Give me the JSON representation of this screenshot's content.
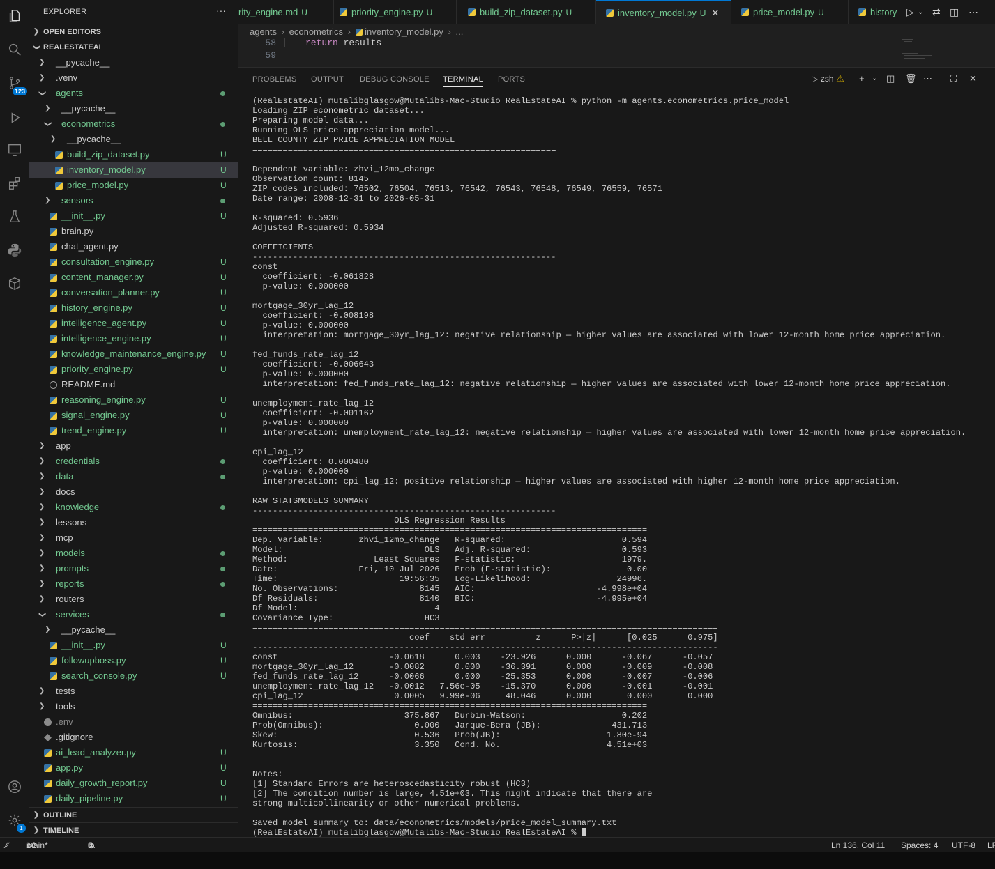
{
  "explorer": {
    "title": "EXPLORER",
    "more": "···",
    "open_editors": "OPEN EDITORS",
    "root": "REALESTATEAI",
    "outline": "OUTLINE",
    "timeline": "TIMELINE",
    "items": [
      {
        "label": "__pycache__",
        "kind": "folder",
        "depth": 0,
        "color": "w",
        "badge": ""
      },
      {
        "label": ".venv",
        "kind": "folder",
        "depth": 0,
        "color": "w",
        "badge": ""
      },
      {
        "label": "agents",
        "kind": "folder-open",
        "depth": 0,
        "color": "g",
        "badge": "dot"
      },
      {
        "label": "__pycache__",
        "kind": "folder",
        "depth": 1,
        "color": "w",
        "badge": ""
      },
      {
        "label": "econometrics",
        "kind": "folder-open",
        "depth": 1,
        "color": "g",
        "badge": "dot"
      },
      {
        "label": "__pycache__",
        "kind": "folder",
        "depth": 2,
        "color": "w",
        "badge": ""
      },
      {
        "label": "build_zip_dataset.py",
        "kind": "py",
        "depth": 2,
        "color": "g",
        "badge": "U"
      },
      {
        "label": "inventory_model.py",
        "kind": "py",
        "depth": 2,
        "color": "g",
        "badge": "U",
        "selected": true
      },
      {
        "label": "price_model.py",
        "kind": "py",
        "depth": 2,
        "color": "g",
        "badge": "U"
      },
      {
        "label": "sensors",
        "kind": "folder",
        "depth": 1,
        "color": "g",
        "badge": "dot"
      },
      {
        "label": "__init__.py",
        "kind": "py",
        "depth": 1,
        "color": "g",
        "badge": "U"
      },
      {
        "label": "brain.py",
        "kind": "py",
        "depth": 1,
        "color": "w",
        "badge": ""
      },
      {
        "label": "chat_agent.py",
        "kind": "py",
        "depth": 1,
        "color": "w",
        "badge": ""
      },
      {
        "label": "consultation_engine.py",
        "kind": "py",
        "depth": 1,
        "color": "g",
        "badge": "U"
      },
      {
        "label": "content_manager.py",
        "kind": "py",
        "depth": 1,
        "color": "g",
        "badge": "U"
      },
      {
        "label": "conversation_planner.py",
        "kind": "py",
        "depth": 1,
        "color": "g",
        "badge": "U"
      },
      {
        "label": "history_engine.py",
        "kind": "py",
        "depth": 1,
        "color": "g",
        "badge": "U"
      },
      {
        "label": "intelligence_agent.py",
        "kind": "py",
        "depth": 1,
        "color": "g",
        "badge": "U"
      },
      {
        "label": "intelligence_engine.py",
        "kind": "py",
        "depth": 1,
        "color": "g",
        "badge": "U"
      },
      {
        "label": "knowledge_maintenance_engine.py",
        "kind": "py",
        "depth": 1,
        "color": "g",
        "badge": "U"
      },
      {
        "label": "priority_engine.py",
        "kind": "py",
        "depth": 1,
        "color": "g",
        "badge": "U"
      },
      {
        "label": "README.md",
        "kind": "info",
        "depth": 1,
        "color": "w",
        "badge": ""
      },
      {
        "label": "reasoning_engine.py",
        "kind": "py",
        "depth": 1,
        "color": "g",
        "badge": "U"
      },
      {
        "label": "signal_engine.py",
        "kind": "py",
        "depth": 1,
        "color": "g",
        "badge": "U"
      },
      {
        "label": "trend_engine.py",
        "kind": "py",
        "depth": 1,
        "color": "g",
        "badge": "U"
      },
      {
        "label": "app",
        "kind": "folder",
        "depth": 0,
        "color": "w",
        "badge": ""
      },
      {
        "label": "credentials",
        "kind": "folder",
        "depth": 0,
        "color": "g",
        "badge": "dot"
      },
      {
        "label": "data",
        "kind": "folder",
        "depth": 0,
        "color": "g",
        "badge": "dot"
      },
      {
        "label": "docs",
        "kind": "folder",
        "depth": 0,
        "color": "w",
        "badge": ""
      },
      {
        "label": "knowledge",
        "kind": "folder",
        "depth": 0,
        "color": "g",
        "badge": "dot"
      },
      {
        "label": "lessons",
        "kind": "folder",
        "depth": 0,
        "color": "w",
        "badge": ""
      },
      {
        "label": "mcp",
        "kind": "folder",
        "depth": 0,
        "color": "w",
        "badge": ""
      },
      {
        "label": "models",
        "kind": "folder",
        "depth": 0,
        "color": "g",
        "badge": "dot"
      },
      {
        "label": "prompts",
        "kind": "folder",
        "depth": 0,
        "color": "g",
        "badge": "dot"
      },
      {
        "label": "reports",
        "kind": "folder",
        "depth": 0,
        "color": "g",
        "badge": "dot"
      },
      {
        "label": "routers",
        "kind": "folder",
        "depth": 0,
        "color": "w",
        "badge": ""
      },
      {
        "label": "services",
        "kind": "folder-open",
        "depth": 0,
        "color": "g",
        "badge": "dot"
      },
      {
        "label": "__pycache__",
        "kind": "folder",
        "depth": 1,
        "color": "w",
        "badge": ""
      },
      {
        "label": "__init__.py",
        "kind": "py",
        "depth": 1,
        "color": "g",
        "badge": "U"
      },
      {
        "label": "followupboss.py",
        "kind": "py",
        "depth": 1,
        "color": "g",
        "badge": "U"
      },
      {
        "label": "search_console.py",
        "kind": "py",
        "depth": 1,
        "color": "g",
        "badge": "U"
      },
      {
        "label": "tests",
        "kind": "folder",
        "depth": 0,
        "color": "w",
        "badge": ""
      },
      {
        "label": "tools",
        "kind": "folder",
        "depth": 0,
        "color": "w",
        "badge": ""
      },
      {
        "label": ".env",
        "kind": "gear",
        "depth": 0,
        "color": "gy",
        "badge": ""
      },
      {
        "label": ".gitignore",
        "kind": "git",
        "depth": 0,
        "color": "w",
        "badge": ""
      },
      {
        "label": "ai_lead_analyzer.py",
        "kind": "py",
        "depth": 0,
        "color": "g",
        "badge": "U"
      },
      {
        "label": "app.py",
        "kind": "py",
        "depth": 0,
        "color": "g",
        "badge": "U"
      },
      {
        "label": "daily_growth_report.py",
        "kind": "py",
        "depth": 0,
        "color": "g",
        "badge": "U"
      },
      {
        "label": "daily_pipeline.py",
        "kind": "py",
        "depth": 0,
        "color": "g",
        "badge": "U"
      }
    ]
  },
  "activity": {
    "scm_badge": "123",
    "settings_badge": "1"
  },
  "tabs": [
    {
      "label": "rity_engine.md",
      "badge": "U",
      "icon": "md",
      "active": false
    },
    {
      "label": "priority_engine.py",
      "badge": "U",
      "icon": "py",
      "active": false
    },
    {
      "label": "build_zip_dataset.py",
      "badge": "U",
      "icon": "py",
      "active": false
    },
    {
      "label": "inventory_model.py",
      "badge": "U",
      "icon": "py",
      "active": true
    },
    {
      "label": "price_model.py",
      "badge": "U",
      "icon": "py",
      "active": false
    },
    {
      "label": "history",
      "badge": "",
      "icon": "py",
      "active": false
    }
  ],
  "breadcrumb": [
    "agents",
    "econometrics",
    "inventory_model.py",
    "..."
  ],
  "code": {
    "lines": [
      {
        "num": "58",
        "kw": "return",
        "text": "results"
      },
      {
        "num": "59",
        "kw": "",
        "text": ""
      }
    ]
  },
  "panel": {
    "tabs": [
      "PROBLEMS",
      "OUTPUT",
      "DEBUG CONSOLE",
      "TERMINAL",
      "PORTS"
    ],
    "active_tab": "TERMINAL",
    "shell": "zsh"
  },
  "terminal": {
    "lines": [
      "(RealEstateAI) mutalibglasgow@Mutalibs-Mac-Studio RealEstateAI % python -m agents.econometrics.price_model",
      "Loading ZIP econometric dataset...",
      "Preparing model data...",
      "Running OLS price appreciation model...",
      "BELL COUNTY ZIP PRICE APPRECIATION MODEL",
      "============================================================",
      "",
      "Dependent variable: zhvi_12mo_change",
      "Observation count: 8145",
      "ZIP codes included: 76502, 76504, 76513, 76542, 76543, 76548, 76549, 76559, 76571",
      "Date range: 2008-12-31 to 2026-05-31",
      "",
      "R-squared: 0.5936",
      "Adjusted R-squared: 0.5934",
      "",
      "COEFFICIENTS",
      "------------------------------------------------------------",
      "const",
      "  coefficient: -0.061828",
      "  p-value: 0.000000",
      "",
      "mortgage_30yr_lag_12",
      "  coefficient: -0.008198",
      "  p-value: 0.000000",
      "  interpretation: mortgage_30yr_lag_12: negative relationship — higher values are associated with lower 12-month home price appreciation.",
      "",
      "fed_funds_rate_lag_12",
      "  coefficient: -0.006643",
      "  p-value: 0.000000",
      "  interpretation: fed_funds_rate_lag_12: negative relationship — higher values are associated with lower 12-month home price appreciation.",
      "",
      "unemployment_rate_lag_12",
      "  coefficient: -0.001162",
      "  p-value: 0.000000",
      "  interpretation: unemployment_rate_lag_12: negative relationship — higher values are associated with lower 12-month home price appreciation.",
      "",
      "cpi_lag_12",
      "  coefficient: 0.000480",
      "  p-value: 0.000000",
      "  interpretation: cpi_lag_12: positive relationship — higher values are associated with higher 12-month home price appreciation.",
      "",
      "RAW STATSMODELS SUMMARY",
      "------------------------------------------------------------",
      "                            OLS Regression Results",
      "==============================================================================",
      "Dep. Variable:       zhvi_12mo_change   R-squared:                       0.594",
      "Model:                            OLS   Adj. R-squared:                  0.593",
      "Method:                 Least Squares   F-statistic:                     1979.",
      "Date:                Fri, 10 Jul 2026   Prob (F-statistic):               0.00",
      "Time:                        19:56:35   Log-Likelihood:                 24996.",
      "No. Observations:                8145   AIC:                        -4.998e+04",
      "Df Residuals:                    8140   BIC:                        -4.995e+04",
      "Df Model:                           4",
      "Covariance Type:                  HC3",
      "============================================================================================",
      "                               coef    std err          z      P>|z|      [0.025      0.975]",
      "--------------------------------------------------------------------------------------------",
      "const                      -0.0618      0.003    -23.926      0.000      -0.067      -0.057",
      "mortgage_30yr_lag_12       -0.0082      0.000    -36.391      0.000      -0.009      -0.008",
      "fed_funds_rate_lag_12      -0.0066      0.000    -25.353      0.000      -0.007      -0.006",
      "unemployment_rate_lag_12   -0.0012   7.56e-05    -15.370      0.000      -0.001      -0.001",
      "cpi_lag_12                  0.0005   9.99e-06     48.046      0.000       0.000       0.000",
      "==============================================================================",
      "Omnibus:                      375.867   Durbin-Watson:                   0.202",
      "Prob(Omnibus):                  0.000   Jarque-Bera (JB):              431.713",
      "Skew:                           0.536   Prob(JB):                     1.80e-94",
      "Kurtosis:                       3.350   Cond. No.                     4.51e+03",
      "==============================================================================",
      "",
      "Notes:",
      "[1] Standard Errors are heteroscedasticity robust (HC3)",
      "[2] The condition number is large, 4.51e+03. This might indicate that there are",
      "strong multicollinearity or other numerical problems.",
      "",
      "Saved model summary to: data/econometrics/models/price_model_summary.txt"
    ],
    "prompt": "(RealEstateAI) mutalibglasgow@Mutalibs-Mac-Studio RealEstateAI % "
  },
  "status": {
    "branch": "main*",
    "errors": "0",
    "warnings": "0",
    "position": "Ln 136, Col 11",
    "spaces": "Spaces: 4",
    "encoding": "UTF-8",
    "eol": "LF"
  },
  "colors": {
    "accent": "#0078d4",
    "untracked": "#73c991",
    "keyword": "#c586c0"
  }
}
